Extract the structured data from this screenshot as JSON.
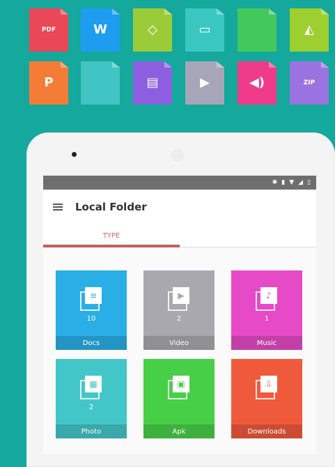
{
  "file_types": [
    {
      "label": "PDF",
      "glyph": "",
      "color": "#e84857"
    },
    {
      "label": "",
      "glyph": "W",
      "color": "#1e9cf0"
    },
    {
      "label": "",
      "glyph": "◇",
      "color": "#9ccb3a"
    },
    {
      "label": "",
      "glyph": "▭",
      "color": "#3bc7c1"
    },
    {
      "label": "",
      "glyph": "",
      "color": "#43c95b"
    },
    {
      "label": "",
      "glyph": "◭",
      "color": "#9ccf2f"
    },
    {
      "label": "",
      "glyph": "P",
      "color": "#f57c37"
    },
    {
      "label": "",
      "glyph": "",
      "color": "#40c4c4"
    },
    {
      "label": "",
      "glyph": "▤",
      "color": "#8d5fe0"
    },
    {
      "label": "",
      "glyph": "▶",
      "color": "#a6a6b8"
    },
    {
      "label": "",
      "glyph": "◀)",
      "color": "#ee3b8a"
    },
    {
      "label": "ZIP",
      "glyph": "",
      "color": "#9b73e0"
    }
  ],
  "app": {
    "title": "Local Folder",
    "tabs": [
      "TYPE",
      ""
    ],
    "active_tab": 0
  },
  "categories": [
    {
      "name": "Docs",
      "count": "10",
      "color": "#2aaee6",
      "glyph": "≡"
    },
    {
      "name": "Video",
      "count": "2",
      "color": "#a8a8ae",
      "glyph": "▶"
    },
    {
      "name": "Music",
      "count": "1",
      "color": "#e64ac6",
      "glyph": "♪"
    },
    {
      "name": "Photo",
      "count": "2",
      "color": "#43c6c8",
      "glyph": "▦"
    },
    {
      "name": "Apk",
      "count": "",
      "color": "#48cf48",
      "glyph": "▣"
    },
    {
      "name": "Downloads",
      "count": "",
      "color": "#f05a3c",
      "glyph": "⇩"
    }
  ]
}
